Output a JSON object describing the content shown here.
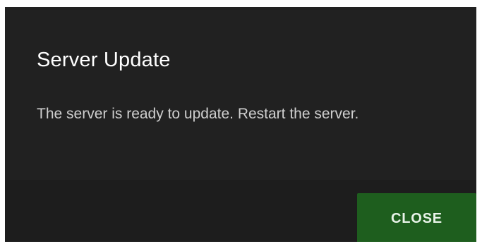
{
  "dialog": {
    "title": "Server Update",
    "message": "The server is ready to update. Restart the server.",
    "actions": {
      "close_label": "CLOSE"
    }
  },
  "colors": {
    "dialog_background": "#212121",
    "actions_background": "#1d1d1d",
    "button_background": "#1e5e1e",
    "title_text": "#ffffff",
    "body_text": "#cfcfcf"
  }
}
